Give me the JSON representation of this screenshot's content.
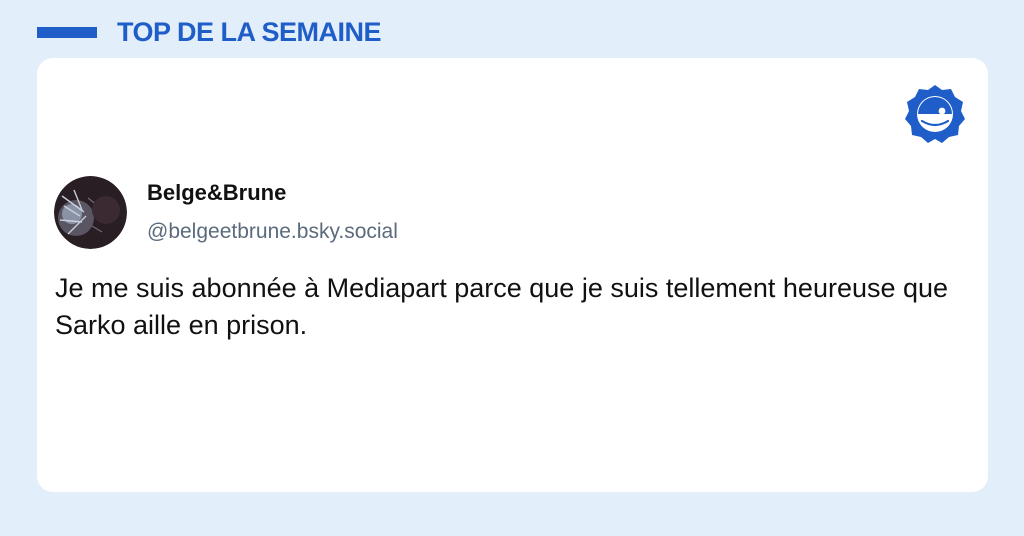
{
  "header": {
    "title": "TOP DE LA SEMAINE"
  },
  "post": {
    "author_name": "Belge&Brune",
    "author_handle": "@belgeetbrune.bsky.social",
    "text": "Je me suis abonnée à Mediapart parce que je suis tellement heureuse que Sarko aille en prison."
  },
  "icons": {
    "brand": "bluesky-face-badge-icon",
    "avatar": "user-avatar"
  },
  "colors": {
    "background": "#e3eefb",
    "accent": "#1f5ec8",
    "card": "#ffffff",
    "handle": "#5b6b7c",
    "text": "#111111"
  }
}
